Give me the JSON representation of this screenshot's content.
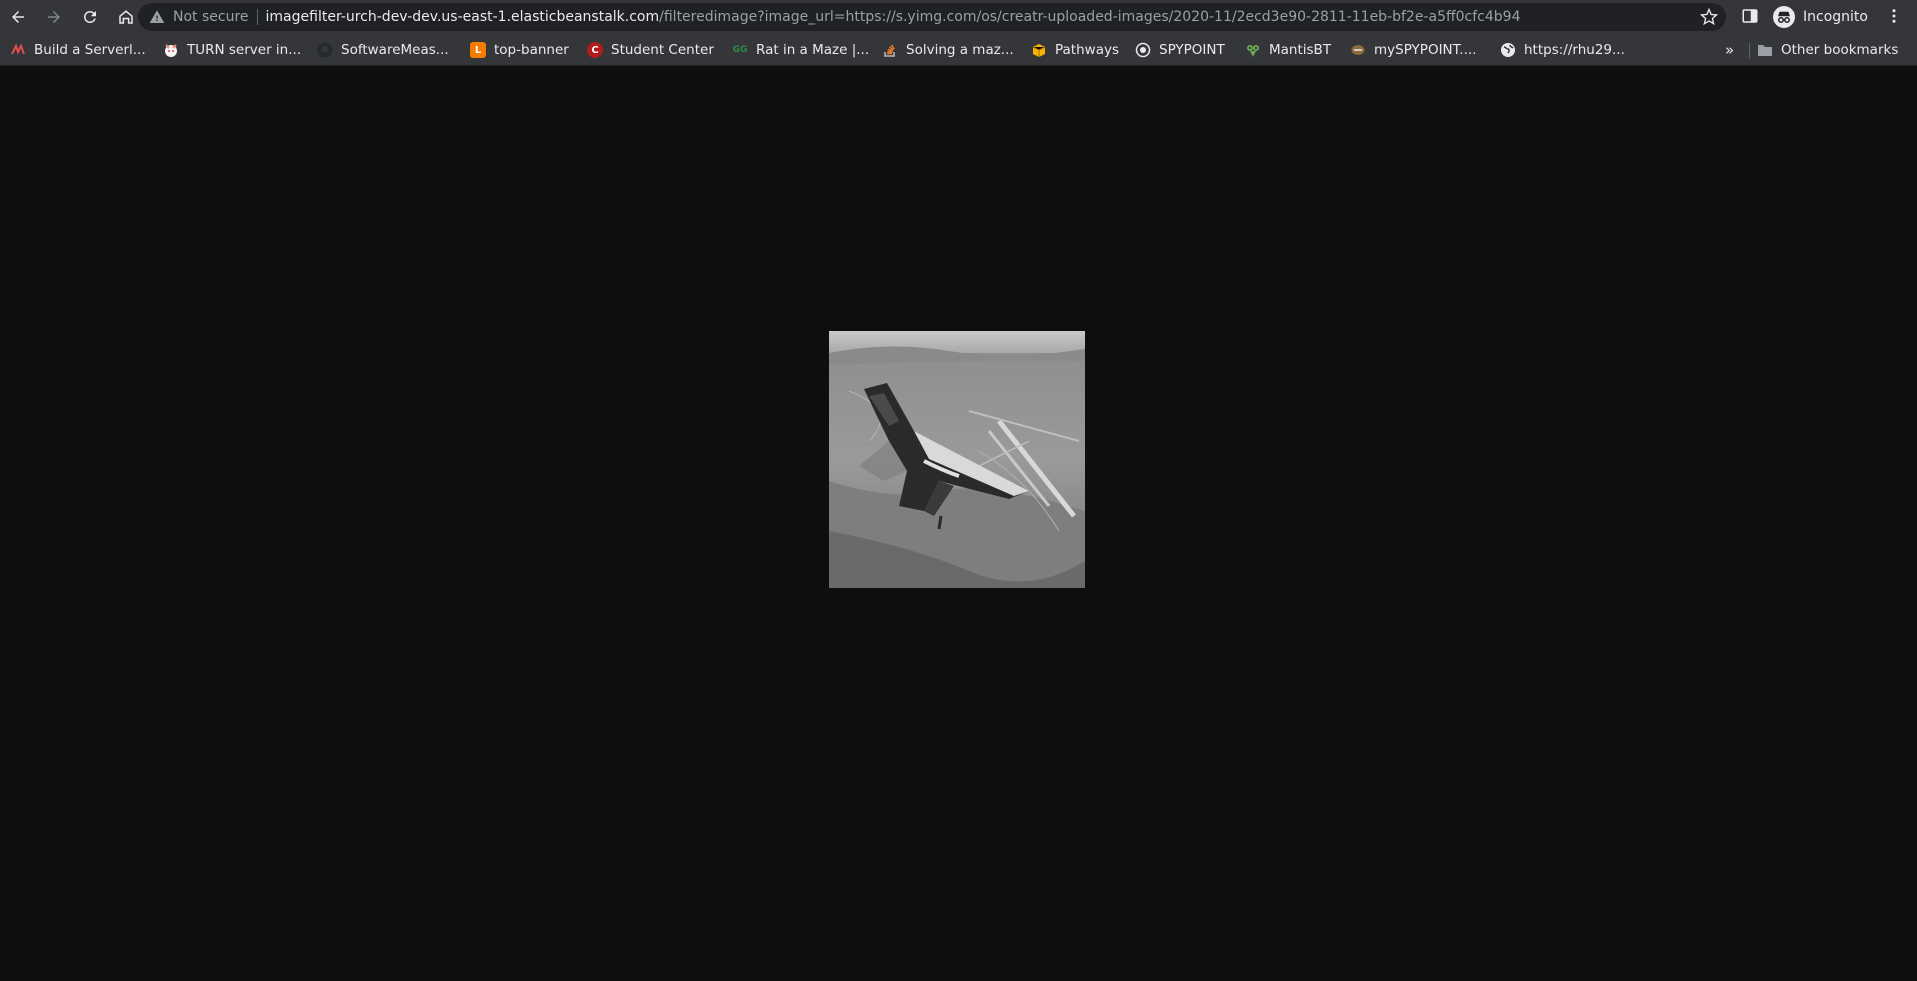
{
  "browser": {
    "not_secure_label": "Not secure",
    "url_host": "imagefilter-urch-dev-dev.us-east-1.elasticbeanstalk.com",
    "url_path": "/filteredimage?image_url=https://s.yimg.com/os/creatr-uploaded-images/2020-11/2ecd3e90-2811-11eb-bf2e-a5ff0cfc4b94",
    "profile_label": "Incognito"
  },
  "bookmarks": {
    "items": [
      {
        "label": "Build a Serverl...",
        "icon": "serverless-icon",
        "color": "#e34c4c"
      },
      {
        "label": "TURN server in...",
        "icon": "turn-icon",
        "color": "#f28b82"
      },
      {
        "label": "SoftwareMeas...",
        "icon": "github-icon",
        "color": "#24292e"
      },
      {
        "label": "top-banner",
        "icon": "lucidchart-icon",
        "color": "#f57c00"
      },
      {
        "label": "Student Center",
        "icon": "cornell-icon",
        "color": "#b31b1b"
      },
      {
        "label": "Rat in a Maze |...",
        "icon": "geeksforgeeks-icon",
        "color": "#2f8d46"
      },
      {
        "label": "Solving a maz...",
        "icon": "stackoverflow-icon",
        "color": "#f48024"
      },
      {
        "label": "Pathways",
        "icon": "box-icon",
        "color": "#f6b400"
      },
      {
        "label": "SPYPOINT",
        "icon": "spypoint-icon",
        "color": "#555555"
      },
      {
        "label": "MantisBT",
        "icon": "mantis-icon",
        "color": "#6aa84f"
      },
      {
        "label": "mySPYPOINT....",
        "icon": "myspypoint-icon",
        "color": "#8a6d3b"
      },
      {
        "label": "https://rhu29...",
        "icon": "globe-icon",
        "color": "#e8eaed"
      }
    ],
    "overflow_label": "»",
    "other_label": "Other bookmarks"
  },
  "colors": {
    "toolbar_bg": "#35363a",
    "omnibox_bg": "#202124",
    "page_bg": "#0e0e0e"
  },
  "page": {
    "image_description": "grayscale aerial photo of a spaceplane in flight over desert runway"
  }
}
